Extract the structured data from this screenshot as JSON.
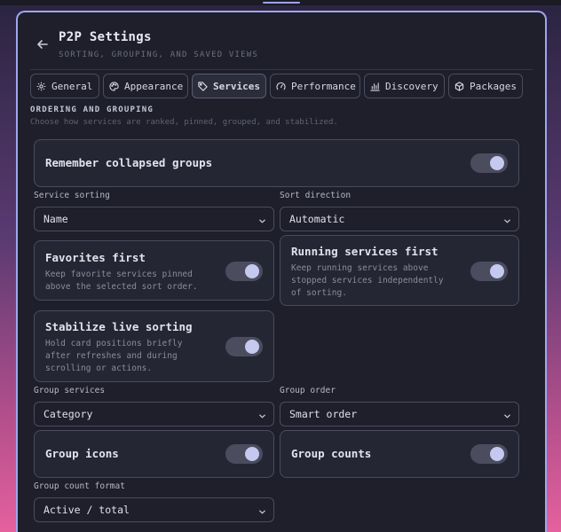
{
  "header": {
    "title": "P2P Settings",
    "subtitle": "SORTING, GROUPING, AND SAVED VIEWS"
  },
  "tabs": [
    {
      "label": "General",
      "icon": "gear-icon",
      "active": false
    },
    {
      "label": "Appearance",
      "icon": "palette-icon",
      "active": false
    },
    {
      "label": "Services",
      "icon": "tag-icon",
      "active": true
    },
    {
      "label": "Performance",
      "icon": "gauge-icon",
      "active": false
    },
    {
      "label": "Discovery",
      "icon": "radar-icon",
      "active": false
    },
    {
      "label": "Packages",
      "icon": "package-icon",
      "active": false
    }
  ],
  "section": {
    "title": "ORDERING AND GROUPING",
    "description": "Choose how services are ranked, pinned, grouped, and stabilized."
  },
  "remember_collapsed": {
    "label": "Remember collapsed groups",
    "enabled": true
  },
  "service_sorting": {
    "label": "Service sorting",
    "value": "Name"
  },
  "sort_direction": {
    "label": "Sort direction",
    "value": "Automatic"
  },
  "favorites_first": {
    "label": "Favorites first",
    "description_line1": "Keep favorite services pinned",
    "description_line2": "above the selected sort order.",
    "enabled": true
  },
  "running_first": {
    "label": "Running services first",
    "description_line1": "Keep running services above",
    "description_line2": "stopped services independently",
    "description_line3": "of sorting.",
    "enabled": true
  },
  "stabilize_sorting": {
    "label": "Stabilize live sorting",
    "description_line1": "Hold card positions briefly",
    "description_line2": "after refreshes and during",
    "description_line3": "scrolling or actions.",
    "enabled": true
  },
  "group_services": {
    "label": "Group services",
    "value": "Category"
  },
  "group_order": {
    "label": "Group order",
    "value": "Smart order"
  },
  "group_icons": {
    "label": "Group icons",
    "enabled": true
  },
  "group_counts": {
    "label": "Group counts",
    "enabled": true
  },
  "group_count_format": {
    "label": "Group count format",
    "value": "Active / total"
  },
  "colors": {
    "accent": "#9fa6ee",
    "panel": "#1e1f2b",
    "card": "#252633",
    "toggle_track": "#4b4d5f",
    "toggle_knob": "#c5c9f0"
  }
}
